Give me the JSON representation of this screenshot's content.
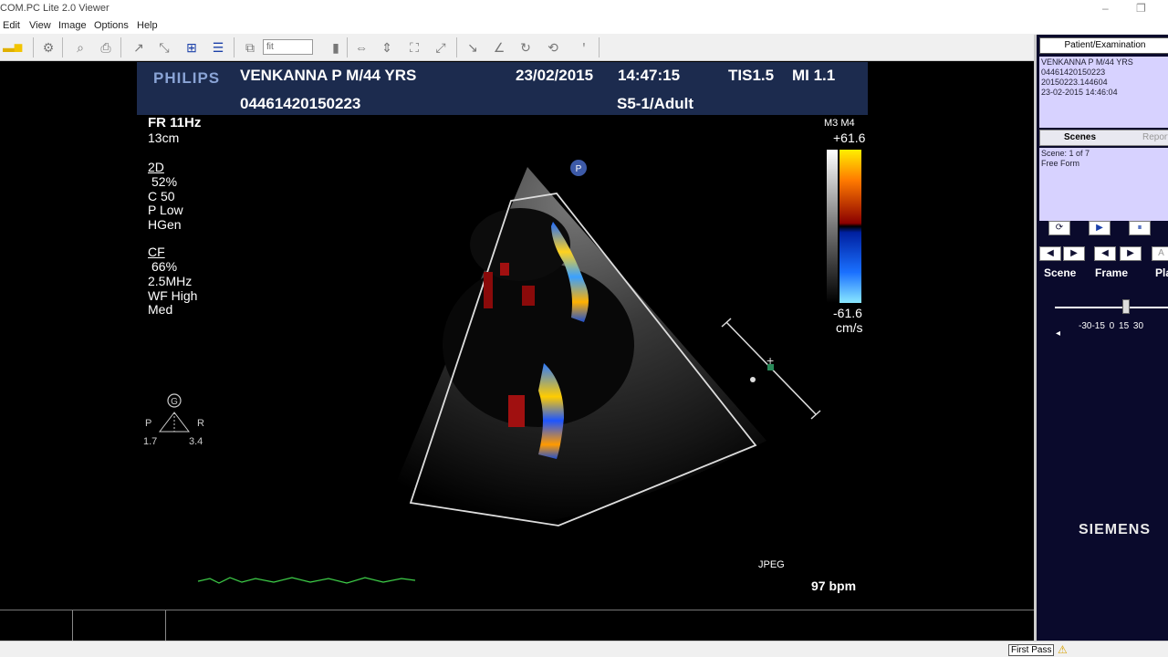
{
  "window": {
    "title": "COM.PC Lite 2.0 Viewer"
  },
  "menu": [
    "Edit",
    "View",
    "Image",
    "Options",
    "Help"
  ],
  "toolbar": {
    "zoom_value": "fit"
  },
  "header": {
    "brand": "PHILIPS",
    "patient": "VENKANNA P M/44 YRS",
    "patient_id": "04461420150223",
    "date": "23/02/2015",
    "time": "14:47:15",
    "tis": "TIS1.5",
    "mi": "MI 1.1",
    "probe": "S5-1/Adult"
  },
  "overlay": {
    "fr": "FR 11Hz",
    "depth": "13cm",
    "mode_2d": "2D",
    "gain_2d": "52%",
    "c": "C 50",
    "p": "P Low",
    "hgen": "HGen",
    "mode_cf": "CF",
    "gain_cf": "66%",
    "freq": "2.5MHz",
    "wf": "WF High",
    "med": "Med",
    "orient_g": "G",
    "orient_p": "P",
    "orient_r": "R",
    "scale_left": "1.7",
    "scale_right": "3.4",
    "probe_marker": "P",
    "color_mode": "M3 M4",
    "vel_max": "+61.6",
    "vel_min": "-61.6",
    "vel_unit": "cm/s",
    "jpeg": "JPEG",
    "heart_rate": "97 bpm"
  },
  "right_panel": {
    "tab_patient": "Patient/Examination",
    "patient_info": [
      "VENKANNA P M/44 YRS",
      "04461420150223",
      "20150223.144604",
      "23-02-2015 14:46:04"
    ],
    "tab_scenes": "Scenes",
    "tab_reports": "Reports",
    "scene_info": [
      "Scene: 1 of 7",
      "Free Form"
    ],
    "label_scene": "Scene",
    "label_frame": "Frame",
    "label_play": "Play",
    "slider_ticks": "-30-15  0  15 30",
    "vendor": "SIEMENS"
  },
  "statusbar": {
    "first_pass": "First Pass"
  }
}
